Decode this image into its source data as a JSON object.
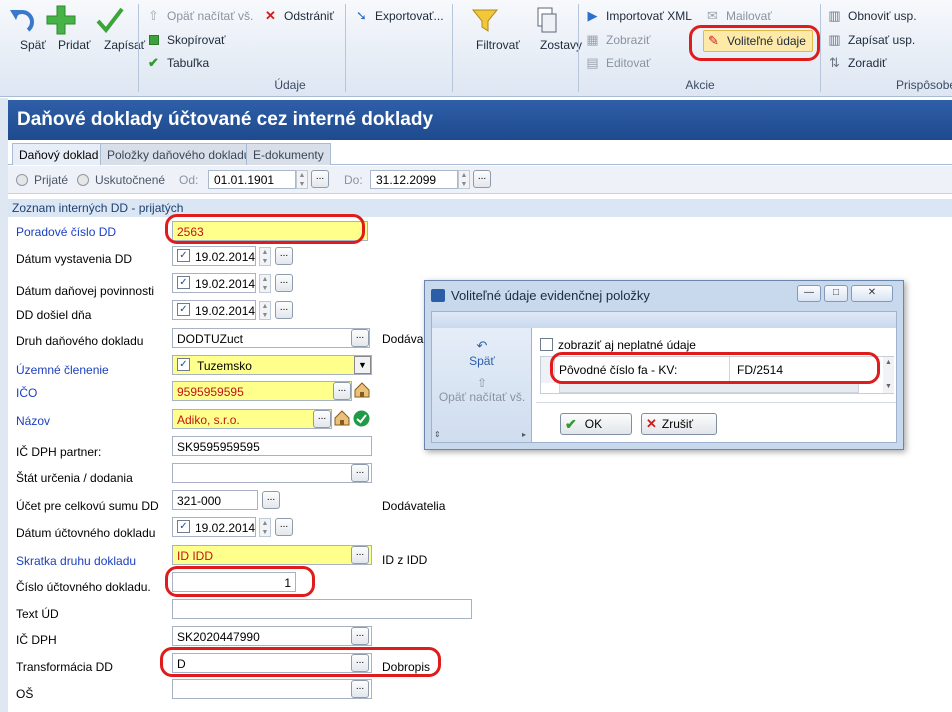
{
  "ribbon": {
    "back": "Späť",
    "add": "Pridať",
    "save": "Zapísať",
    "reload_all": "Opäť načítať vš.",
    "delete": "Odstrániť",
    "copy": "Skopírovať",
    "table": "Tabuľka",
    "export": "Exportovať...",
    "filter": "Filtrovať",
    "reports": "Zostavy",
    "import_xml": "Importovať XML",
    "show": "Zobraziť",
    "edit": "Editovať",
    "mail": "Mailovať",
    "optional_data": "Voliteľné údaje",
    "refresh_custom": "Obnoviť usp.",
    "save_custom": "Zapísať usp.",
    "sort": "Zoradiť",
    "group_data": "Údaje",
    "group_actions": "Akcie",
    "group_customize": "Prispôsobe"
  },
  "title": "Daňové doklady účtované cez interné doklady",
  "tabs": [
    "Daňový doklad",
    "Položky daňového dokladu",
    "E-dokumenty"
  ],
  "filter": {
    "received": "Prijaté",
    "issued": "Uskutočnené",
    "from_label": "Od:",
    "from": "01.01.1901",
    "to_label": "Do:",
    "to": "31.12.2099"
  },
  "list_header": "Zoznam interných DD - prijatých",
  "form": {
    "poradove_label": "Poradové číslo DD",
    "poradove": "2563",
    "vystavenia_label": "Dátum vystavenia DD",
    "vystavenia": "19.02.2014",
    "povinnosti_label": "Dátum daňovej povinnosti",
    "povinnosti": "19.02.2014",
    "dosiel_label": "DD došiel dňa",
    "dosiel": "19.02.2014",
    "druh_label": "Druh daňového dokladu",
    "druh": "DODTUZuct",
    "druh_side": "Dodáva",
    "uzemne_label": "Územné členenie",
    "uzemne": "Tuzemsko",
    "ico_label": "IČO",
    "ico": "9595959595",
    "nazov_label": "Názov",
    "nazov": "Adiko, s.r.o.",
    "icdph_partner_label": "IČ DPH partner:",
    "icdph_partner": "SK9595959595",
    "stat_label": "Štát určenia / dodania",
    "stat": "",
    "ucet_label": "Účet pre celkovú sumu DD",
    "ucet": "321-000",
    "ucet_side": "Dodávatelia",
    "datum_ucto_label": "Dátum účtovného dokladu",
    "datum_ucto": "19.02.2014",
    "skratka_label": "Skratka druhu dokladu",
    "skratka": "ID IDD",
    "skratka_side": "ID z IDD",
    "cislo_label": "Číslo účtovného dokladu.",
    "cislo": "1",
    "text_label": "Text ÚD",
    "text": "",
    "icdph_label": "IČ DPH",
    "icdph": "SK2020447990",
    "transf_label": "Transformácia DD",
    "transf": "D",
    "transf_side": "Dobropis",
    "os_label": "OŠ",
    "os": ""
  },
  "dialog": {
    "title": "Voliteľné údaje evidenčnej položky",
    "back": "Späť",
    "reload": "Opäť načítať vš.",
    "show_invalid": "zobraziť aj neplatné údaje",
    "field_label": "Pôvodné číslo fa - KV:",
    "field_value": "FD/2514",
    "ok": "OK",
    "cancel": "Zrušiť"
  },
  "colors": {
    "title_bg": "#1e4a8e",
    "highlight": "#ffff8c",
    "marker": "#e01b1b"
  }
}
